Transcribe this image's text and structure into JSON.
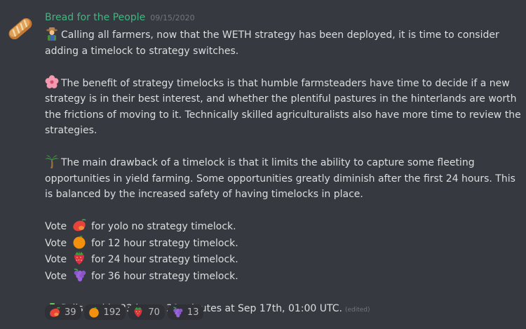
{
  "message": {
    "username": "Bread for the People",
    "timestamp": "09/15/2020",
    "paragraphs": {
      "p1": {
        "emoji": "farmer-icon",
        "text": "Calling all farmers, now that the WETH strategy has been deployed, it is time to consider adding a timelock to strategy switches."
      },
      "p2": {
        "emoji": "hibiscus-icon",
        "text": "The benefit of strategy timelocks is that humble farmsteaders have time to decide if a new strategy is in their best interest, and whether the plentiful pastures in the hinterlands are worth the frictions of moving to it. Technically skilled agriculturalists also have more time to review the strategies."
      },
      "p3": {
        "emoji": "palm-tree-icon",
        "text": "The main drawback of a timelock is that it limits the ability to capture some fleeting opportunities in yield farming. Some opportunities greatly diminish after the first 24 hours. This is balanced by the increased safety of having timelocks in place."
      }
    },
    "votes": [
      {
        "prefix": "Vote",
        "emoji": "mango-icon",
        "text": "for yolo no strategy timelock."
      },
      {
        "prefix": "Vote",
        "emoji": "orange-icon",
        "text": "for 12 hour strategy timelock."
      },
      {
        "prefix": "Vote",
        "emoji": "strawberry-icon",
        "text": "for 24 hour strategy timelock."
      },
      {
        "prefix": "Vote",
        "emoji": "grapes-icon",
        "text": "for 36 hour strategy timelock."
      }
    ],
    "poll_end": {
      "emoji": "tractor-icon",
      "text": "Polls end in 23 hours 30 minutes at Sep 17th, 01:00 UTC.",
      "edited": "(edited)"
    }
  },
  "reactions": [
    {
      "emoji": "mango-icon",
      "count": "39"
    },
    {
      "emoji": "orange-icon",
      "count": "192"
    },
    {
      "emoji": "strawberry-icon",
      "count": "70"
    },
    {
      "emoji": "grapes-icon",
      "count": "13"
    }
  ],
  "colors": {
    "background": "#36393f",
    "username": "#43b581",
    "text": "#dcddde",
    "muted": "#72767d",
    "reaction_bg": "#2f3136"
  }
}
